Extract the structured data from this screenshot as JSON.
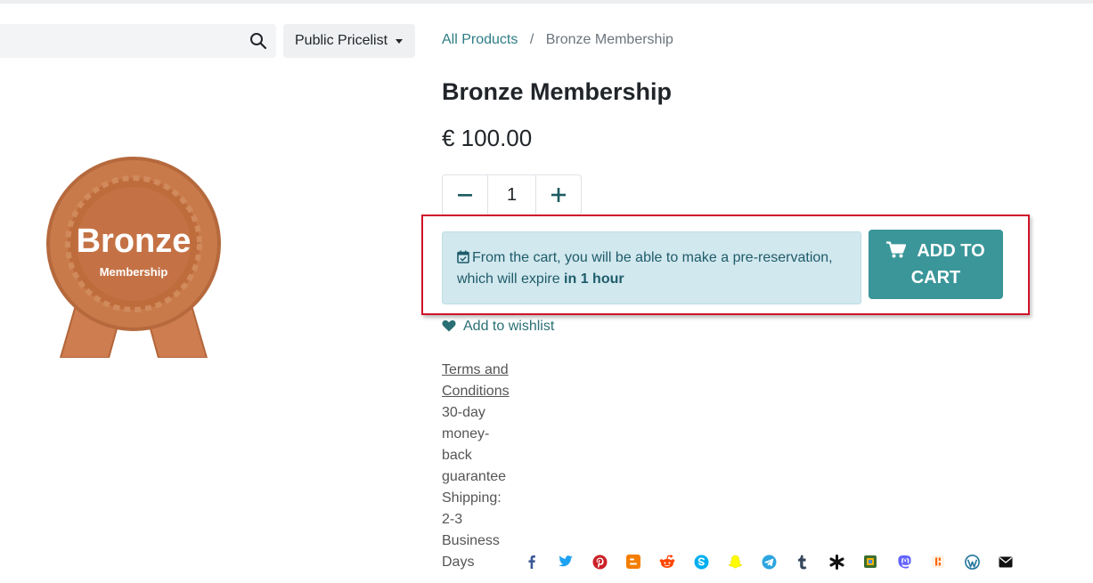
{
  "search": {
    "placeholder": "",
    "value": ""
  },
  "pricelist": {
    "label": "Public Pricelist"
  },
  "breadcrumb": {
    "parent": "All Products",
    "current": "Bronze Membership"
  },
  "product": {
    "name": "Bronze Membership",
    "price": "€ 100.00",
    "quantity": "1",
    "image": {
      "main": "Bronze",
      "sub": "Membership"
    }
  },
  "notice": {
    "icon": "calendar-check-icon",
    "text": "From the cart, you will be able to make a pre-reservation, which will expire",
    "emphasis": "in 1 hour"
  },
  "cart_button": {
    "line1": "ADD TO",
    "line2": "CART",
    "icon": "shopping-cart-icon"
  },
  "wishlist": {
    "label": "Add to wishlist",
    "icon": "heart-icon"
  },
  "terms": {
    "link": "Terms and Conditions",
    "lines": [
      "30-day",
      "money-",
      "back",
      "guarantee",
      "Shipping:",
      "2-3",
      "Business",
      "Days"
    ]
  },
  "share_icons": [
    "facebook-icon",
    "twitter-icon",
    "pinterest-icon",
    "blogger-icon",
    "reddit-icon",
    "skype-icon",
    "snapchat-icon",
    "telegram-icon",
    "tumblr-icon",
    "delicious-icon",
    "gmail-icon",
    "mastodon-icon",
    "hacker-news-icon",
    "wordpress-icon",
    "email-icon"
  ],
  "colors": {
    "accent": "#3b9699",
    "link": "#2e7d86",
    "highlight_border": "#d0142a",
    "notice_bg": "#d1e8ee",
    "bronze": "#c97a4a"
  }
}
